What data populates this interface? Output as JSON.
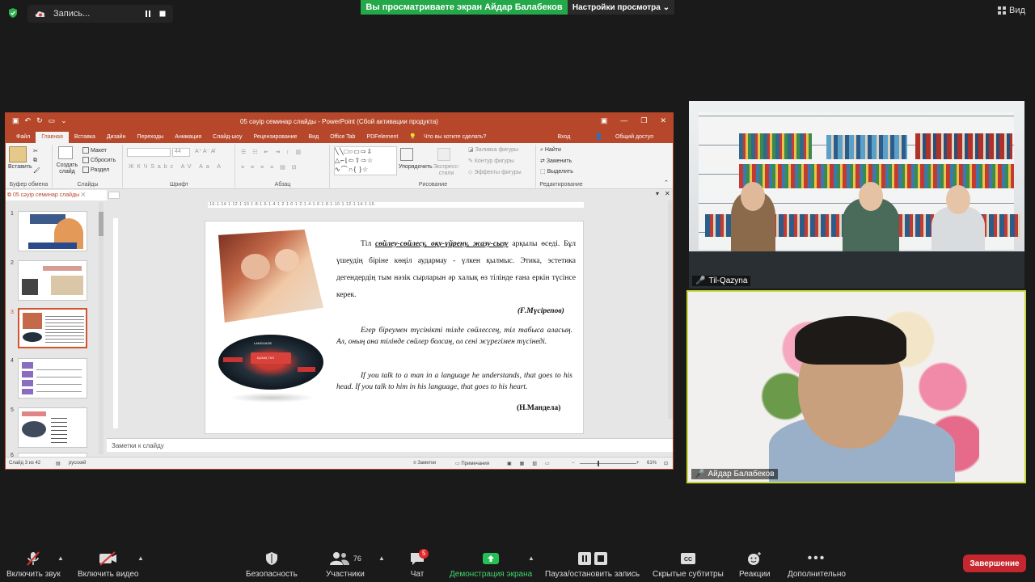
{
  "topbar": {
    "recording_label": "Запись...",
    "share_banner": "Вы просматриваете экран Айдар Балабеков",
    "view_settings": "Настройки просмотра",
    "view_button": "Вид"
  },
  "ppt": {
    "window_title": "05 сәуір семинар слайды - PowerPoint (Сбой активации продукта)",
    "tabs": [
      "Файл",
      "Главная",
      "Вставка",
      "Дизайн",
      "Переходы",
      "Анимация",
      "Слайд-шоу",
      "Рецензирование",
      "Вид",
      "Office Tab",
      "PDFelement",
      "Что вы хотите сделать?"
    ],
    "login": "Вход",
    "share": "Общий доступ",
    "ribbon": {
      "paste": "Вставить",
      "clipboard": "Буфер обмена",
      "create_slide": "Создать слайд",
      "layout": "Макет",
      "reset": "Сбросить",
      "section": "Раздел",
      "slides": "Слайды",
      "font_size": "44",
      "font": "Шрифт",
      "paragraph": "Абзац",
      "arrange": "Упорядочить",
      "express_styles": "Экспресс-стили",
      "shape_fill": "Заливка фигуры",
      "shape_outline": "Контур фигуры",
      "shape_effects": "Эффекты фигуры",
      "drawing": "Рисование",
      "find": "Найти",
      "replace": "Заменить",
      "select": "Выделить",
      "editing": "Редактирование"
    },
    "doc_tab": "05 сәуір семинар слайды",
    "ruler": "·16·1·14·1·12·1·10·1·8·1·6·1·4·1·2·1·0·1·2·1·4·1·6·1·8·1·10·1·12·1·14·1·16·",
    "thumb_numbers": [
      "1",
      "2",
      "3",
      "4",
      "5",
      "6"
    ],
    "notes": "Заметки к слайду",
    "status": {
      "slide": "Слайд 3 из 42",
      "lang": "русский",
      "notes": "Заметки",
      "comments": "Примечания",
      "zoom": "61%"
    },
    "slide": {
      "p1": "Тіл сөйлеу-сөйлесу, оқу-үйрену, жазу-сызу арқылы өседі. Бұл үшеудің біріне көңіл аудармау - үлкен қылмыс. Этика, эстетика дегендердің тым нәзік сырларын әр халық өз тілінде ғана еркін түсінсе керек.",
      "p1_keywords": "сөйлеу-сөйлесу, оқу-үйрену, жазу-сызу",
      "author1": "(Ғ.Мүсірепов)",
      "p2": "Егер біреумен түсінікті тілде сөйлессең, тіл табыса аласың. Ал, оның ана тілінде сөйлер болсаң, ол сені жүрегімен түсінеді.",
      "p3": "If you talk to a man in a language he understands, that goes to his head. If you talk to him in his language, that goes to his heart.",
      "author2": "(Н.Мандела)",
      "image_label": "LANGUAGE",
      "image_center": "ҚАЗАҚ ТІЛІ"
    }
  },
  "tiles": {
    "library_name": "Til-Qazyna",
    "speaker_name": "Айдар Балабеков"
  },
  "bottombar": {
    "audio": "Включить звук",
    "video": "Включить видео",
    "security": "Безопасность",
    "participants": "Участники",
    "participants_count": "76",
    "chat": "Чат",
    "chat_badge": "5",
    "share_screen": "Демонстрация экрана",
    "pause_record": "Пауза/остановить запись",
    "captions": "Скрытые субтитры",
    "reactions": "Реакции",
    "more": "Дополнительно",
    "end": "Завершение"
  },
  "colors": {
    "ppt_accent": "#b7472a",
    "share_green": "#24a84a",
    "end_red": "#c6272e",
    "active_speaker_border": "#c7d93a"
  }
}
